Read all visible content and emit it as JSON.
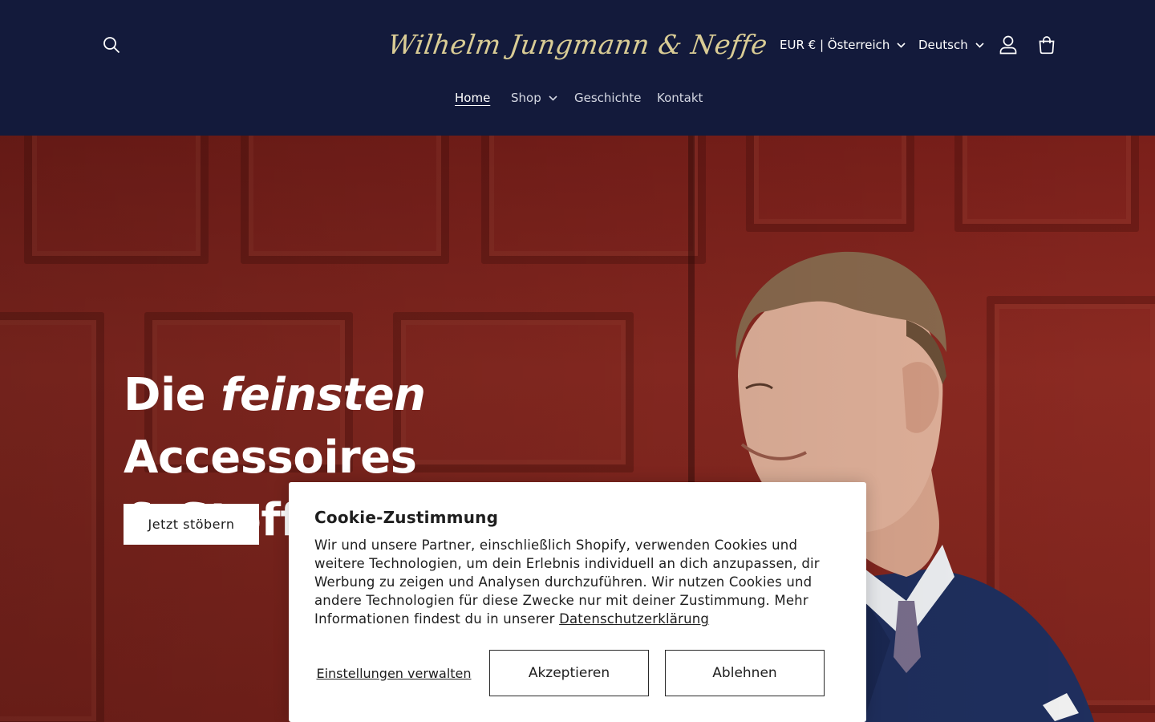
{
  "header": {
    "logo_text": "Wilhelm Jungmann & Neffe",
    "currency": "EUR € | Österreich",
    "language": "Deutsch",
    "icons": {
      "search": "search-icon",
      "account": "user-icon",
      "cart": "cart-icon",
      "dropdown": "chevron-down-icon"
    }
  },
  "nav": {
    "items": [
      {
        "label": "Home",
        "active": true
      },
      {
        "label": "Shop",
        "has_dropdown": true
      },
      {
        "label": "Geschichte"
      },
      {
        "label": "Kontakt"
      }
    ]
  },
  "hero": {
    "title_part1": "Die ",
    "title_emphasis": "feinsten",
    "title_part2": " Accessoires",
    "title_line2": "& Stoffe seit 1866",
    "cta_label": "Jetzt stöbern"
  },
  "cookie_banner": {
    "title": "Cookie-Zustimmung",
    "text": "Wir und unsere Partner, einschließlich Shopify, verwenden Cookies und weitere Technologien, um dein Erlebnis individuell an dich anzupassen, dir Werbung zu zeigen und Analysen durchzuführen. Wir nutzen Cookies und andere Technologien für diese Zwecke nur mit deiner Zustimmung. Mehr Informationen findest du in unserer",
    "privacy_link": "Datenschutzerklärung",
    "manage_label": "Einstellungen verwalten",
    "accept_label": "Akzeptieren",
    "decline_label": "Ablehnen"
  },
  "colors": {
    "header_bg": "#131a3b",
    "logo_gold": "#d9cc95",
    "hero_red": "#8c2a22",
    "dialog_bg": "#ffffff"
  }
}
